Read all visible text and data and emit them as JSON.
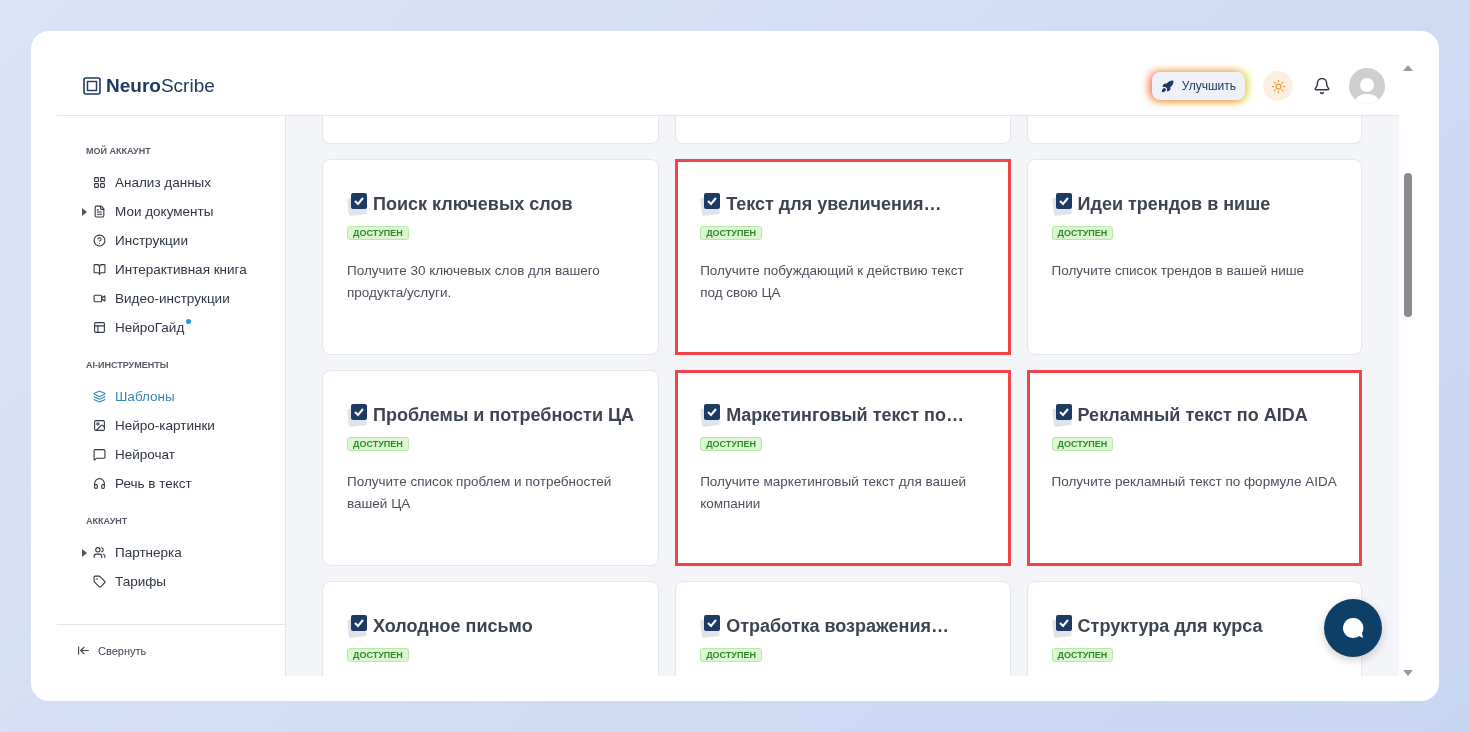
{
  "logo": "**Neuro**Scribe",
  "header": {
    "upgrade_button": "Улучшить"
  },
  "sidebar": {
    "sections": [
      {
        "title": "МОЙ АККАУНТ",
        "items": [
          {
            "label": "Анализ данных",
            "selected": false,
            "collapsible": false,
            "dot": false
          },
          {
            "label": "Мои документы",
            "selected": false,
            "collapsible": true,
            "dot": false
          },
          {
            "label": "Инструкции",
            "selected": false,
            "collapsible": false,
            "dot": false
          },
          {
            "label": "Интерактивная книга",
            "selected": false,
            "collapsible": false,
            "dot": false
          },
          {
            "label": "Видео-инструкции",
            "selected": false,
            "collapsible": false,
            "dot": false
          },
          {
            "label": "НейроГайд",
            "selected": false,
            "collapsible": false,
            "dot": true
          }
        ]
      },
      {
        "title": "AI-ИНСТРУМЕНТЫ",
        "items": [
          {
            "label": "Шаблоны",
            "selected": true,
            "collapsible": false,
            "dot": false
          },
          {
            "label": "Нейро-картинки",
            "selected": false,
            "collapsible": false,
            "dot": false
          },
          {
            "label": "Нейрочат",
            "selected": false,
            "collapsible": false,
            "dot": false
          },
          {
            "label": "Речь в текст",
            "selected": false,
            "collapsible": false,
            "dot": false
          }
        ]
      },
      {
        "title": "АККАУНТ",
        "items": [
          {
            "label": "Партнерка",
            "selected": false,
            "collapsible": true,
            "dot": false
          },
          {
            "label": "Тарифы",
            "selected": false,
            "collapsible": false,
            "dot": false
          }
        ]
      }
    ],
    "collapse_button": "Свернуть"
  },
  "cards": [
    {
      "kind": "cut"
    },
    {
      "kind": "cut"
    },
    {
      "kind": "cut"
    },
    {
      "kind": "full",
      "title": "Поиск ключевых слов",
      "badge": "ДОСТУПЕН",
      "description": "Получите 30 ключевых слов для вашего продукта/услуги.",
      "highlighted": false
    },
    {
      "kind": "full",
      "title": "Текст для увеличения…",
      "badge": "ДОСТУПЕН",
      "description": "Получите побуждающий к действию текст под свою ЦА",
      "highlighted": true
    },
    {
      "kind": "full",
      "title": "Идеи трендов в нише",
      "badge": "ДОСТУПЕН",
      "description": "Получите список трендов в вашей нише",
      "highlighted": false
    },
    {
      "kind": "full",
      "title": "Проблемы и потребности ЦА",
      "badge": "ДОСТУПЕН",
      "description": "Получите список проблем и потребностей вашей ЦА",
      "highlighted": false
    },
    {
      "kind": "full",
      "title": "Маркетинговый текст по…",
      "badge": "ДОСТУПЕН",
      "description": "Получите маркетинговый текст для вашей компании",
      "highlighted": true
    },
    {
      "kind": "full",
      "title": "Рекламный текст по AIDA",
      "badge": "ДОСТУПЕН",
      "description": "Получите рекламный текст по формуле AIDA",
      "highlighted": true
    },
    {
      "kind": "full",
      "title": "Холодное письмо",
      "badge": "ДОСТУПЕН",
      "highlighted": false
    },
    {
      "kind": "full",
      "title": "Отработка возражения…",
      "badge": "ДОСТУПЕН",
      "highlighted": false
    },
    {
      "kind": "full",
      "title": "Структура для курса",
      "badge": "ДОСТУПЕН",
      "highlighted": false
    }
  ]
}
